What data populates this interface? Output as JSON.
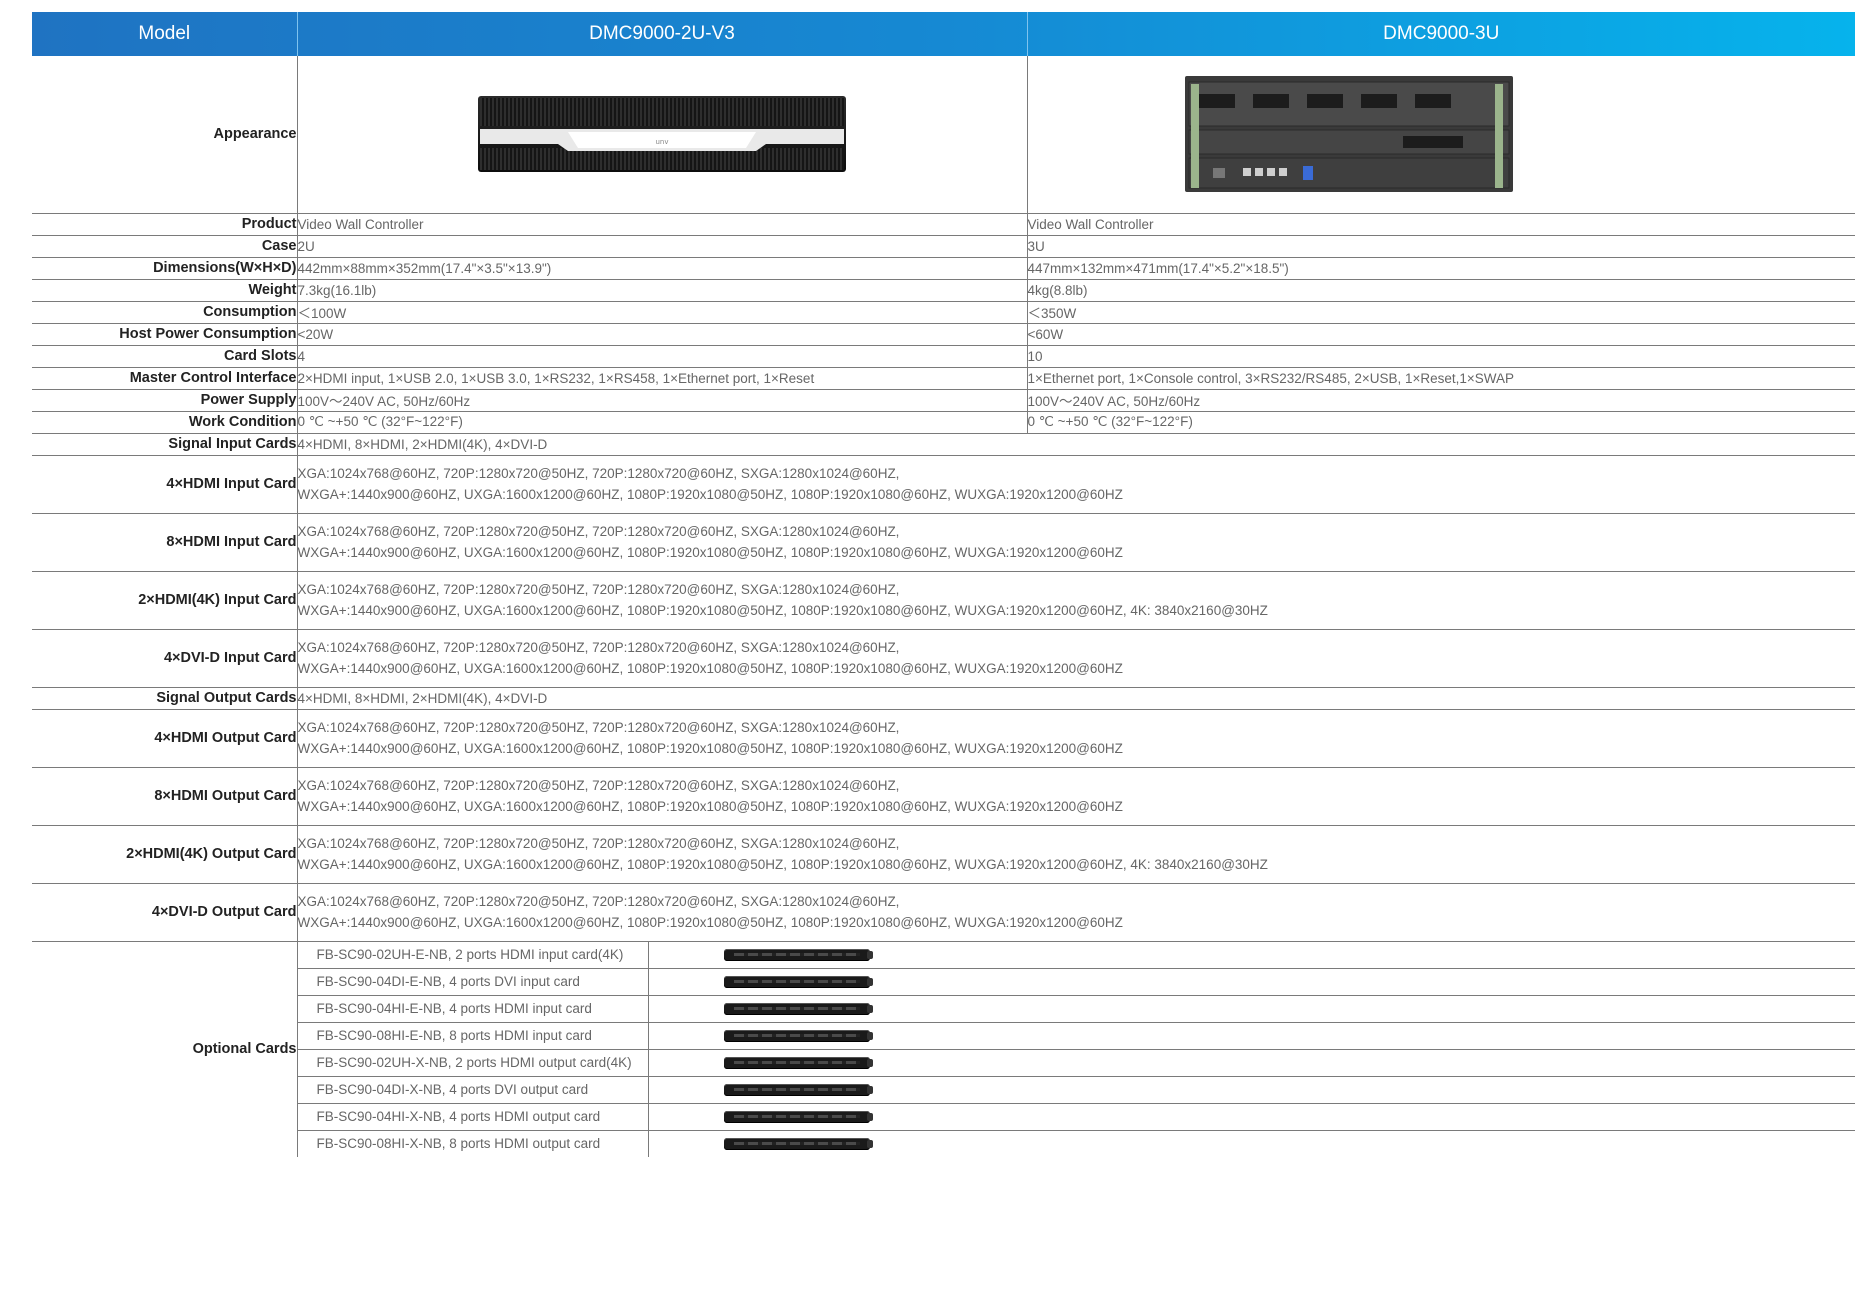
{
  "header": {
    "model_label": "Model",
    "col1": "DMC9000-2U-V3",
    "col2": "DMC9000-3U"
  },
  "appearance_label": "Appearance",
  "rows": {
    "product": {
      "label": "Product",
      "v1": "Video Wall Controller",
      "v2": "Video Wall Controller"
    },
    "case": {
      "label": "Case",
      "v1": "2U",
      "v2": "3U"
    },
    "dimensions": {
      "label": "Dimensions(W×H×D)",
      "v1": "442mm×88mm×352mm(17.4\"×3.5\"×13.9\")",
      "v2": "447mm×132mm×471mm(17.4\"×5.2\"×18.5\")"
    },
    "weight": {
      "label": "Weight",
      "v1": "7.3kg(16.1lb)",
      "v2": "4kg(8.8lb)"
    },
    "consumption": {
      "label": "Consumption",
      "v1": "＜100W",
      "v2": "＜350W"
    },
    "host_power": {
      "label": "Host Power Consumption",
      "v1": "<20W",
      "v2": "<60W"
    },
    "card_slots": {
      "label": "Card Slots",
      "v1": "4",
      "v2": "10"
    },
    "master_control": {
      "label": "Master Control Interface",
      "v1": "2×HDMI input, 1×USB 2.0,  1×USB 3.0, 1×RS232, 1×RS458, 1×Ethernet port, 1×Reset",
      "v2": "1×Ethernet port, 1×Console control, 3×RS232/RS485, 2×USB, 1×Reset,1×SWAP"
    },
    "power_supply": {
      "label": "Power Supply",
      "v1": "100V～240V AC, 50Hz/60Hz",
      "v2": "100V～240V AC, 50Hz/60Hz"
    },
    "work_condition": {
      "label": "Work Condition",
      "v1": "0 ℃ ~+50 ℃ (32°F~122°F)",
      "v2": "0 ℃ ~+50 ℃ (32°F~122°F)"
    },
    "signal_input_cards": {
      "label": "Signal Input Cards",
      "v": "4×HDMI, 8×HDMI, 2×HDMI(4K), 4×DVI-D"
    },
    "hdmi4_input": {
      "label": "4×HDMI Input Card",
      "l1": "XGA:1024x768@60HZ, 720P:1280x720@50HZ, 720P:1280x720@60HZ, SXGA:1280x1024@60HZ,",
      "l2": "WXGA+:1440x900@60HZ, UXGA:1600x1200@60HZ, 1080P:1920x1080@50HZ, 1080P:1920x1080@60HZ, WUXGA:1920x1200@60HZ"
    },
    "hdmi8_input": {
      "label": "8×HDMI Input Card",
      "l1": "XGA:1024x768@60HZ, 720P:1280x720@50HZ, 720P:1280x720@60HZ, SXGA:1280x1024@60HZ,",
      "l2": "WXGA+:1440x900@60HZ, UXGA:1600x1200@60HZ, 1080P:1920x1080@50HZ, 1080P:1920x1080@60HZ, WUXGA:1920x1200@60HZ"
    },
    "hdmi4k_input": {
      "label": "2×HDMI(4K) Input Card",
      "l1": "XGA:1024x768@60HZ, 720P:1280x720@50HZ, 720P:1280x720@60HZ, SXGA:1280x1024@60HZ,",
      "l2": "WXGA+:1440x900@60HZ, UXGA:1600x1200@60HZ, 1080P:1920x1080@50HZ, 1080P:1920x1080@60HZ, WUXGA:1920x1200@60HZ, 4K: 3840x2160@30HZ"
    },
    "dvid4_input": {
      "label": "4×DVI-D Input Card",
      "l1": "XGA:1024x768@60HZ, 720P:1280x720@50HZ, 720P:1280x720@60HZ, SXGA:1280x1024@60HZ,",
      "l2": "WXGA+:1440x900@60HZ, UXGA:1600x1200@60HZ, 1080P:1920x1080@50HZ, 1080P:1920x1080@60HZ, WUXGA:1920x1200@60HZ"
    },
    "signal_output_cards": {
      "label": "Signal Output Cards",
      "v": "4×HDMI, 8×HDMI, 2×HDMI(4K), 4×DVI-D"
    },
    "hdmi4_output": {
      "label": "4×HDMI Output Card",
      "l1": "XGA:1024x768@60HZ, 720P:1280x720@50HZ, 720P:1280x720@60HZ, SXGA:1280x1024@60HZ,",
      "l2": "WXGA+:1440x900@60HZ, UXGA:1600x1200@60HZ, 1080P:1920x1080@50HZ, 1080P:1920x1080@60HZ, WUXGA:1920x1200@60HZ"
    },
    "hdmi8_output": {
      "label": "8×HDMI Output Card",
      "l1": "XGA:1024x768@60HZ, 720P:1280x720@50HZ, 720P:1280x720@60HZ, SXGA:1280x1024@60HZ,",
      "l2": "WXGA+:1440x900@60HZ, UXGA:1600x1200@60HZ, 1080P:1920x1080@50HZ, 1080P:1920x1080@60HZ, WUXGA:1920x1200@60HZ"
    },
    "hdmi4k_output": {
      "label": "2×HDMI(4K) Output Card",
      "l1": "XGA:1024x768@60HZ, 720P:1280x720@50HZ, 720P:1280x720@60HZ, SXGA:1280x1024@60HZ,",
      "l2": "WXGA+:1440x900@60HZ, UXGA:1600x1200@60HZ, 1080P:1920x1080@50HZ, 1080P:1920x1080@60HZ, WUXGA:1920x1200@60HZ, 4K: 3840x2160@30HZ"
    },
    "dvid4_output": {
      "label": "4×DVI-D Output Card",
      "l1": "XGA:1024x768@60HZ, 720P:1280x720@50HZ, 720P:1280x720@60HZ, SXGA:1280x1024@60HZ,",
      "l2": "WXGA+:1440x900@60HZ, UXGA:1600x1200@60HZ, 1080P:1920x1080@50HZ, 1080P:1920x1080@60HZ, WUXGA:1920x1200@60HZ"
    }
  },
  "optional_cards": {
    "label": "Optional Cards",
    "items": [
      "FB-SC90-02UH-E-NB, 2 ports HDMI input card(4K)",
      "FB-SC90-04DI-E-NB, 4 ports DVI input card",
      "FB-SC90-04HI-E-NB, 4 ports HDMI input card",
      "FB-SC90-08HI-E-NB, 8 ports HDMI input card",
      "FB-SC90-02UH-X-NB, 2 ports HDMI output card(4K)",
      "FB-SC90-04DI-X-NB, 4 ports DVI output card",
      "FB-SC90-04HI-X-NB, 4 ports HDMI output card",
      "FB-SC90-08HI-X-NB, 8 ports HDMI output card"
    ]
  },
  "colors": {
    "header_start": "#1f73c2",
    "header_end": "#06b3ec",
    "rule": "#7a7a7a"
  }
}
